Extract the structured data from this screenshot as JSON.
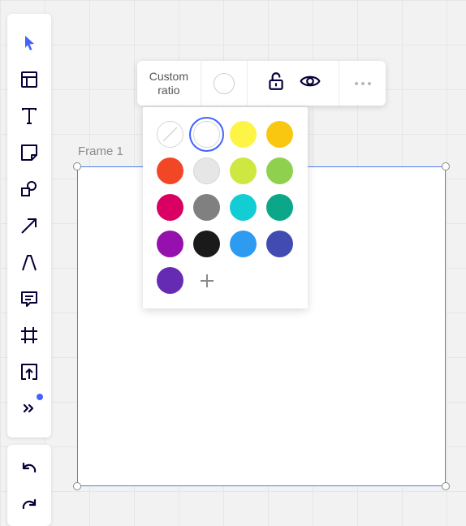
{
  "frame": {
    "label": "Frame 1"
  },
  "context_toolbar": {
    "ratio_line1": "Custom",
    "ratio_line2": "ratio"
  },
  "toolbar_icons": [
    "select-icon",
    "template-icon",
    "text-icon",
    "sticky-note-icon",
    "shapes-icon",
    "arrow-icon",
    "pen-icon",
    "comment-icon",
    "frame-icon",
    "upload-icon",
    "more-tools-icon"
  ],
  "palette": {
    "swatches": [
      "none",
      "#ffffff",
      "#fef445",
      "#fac710",
      "#f24726",
      "#e6e6e6",
      "#cee741",
      "#8fd14f",
      "#da0063",
      "#808080",
      "#12cdd4",
      "#0ca789",
      "#9510ac",
      "#1a1a1a",
      "#2d9bf0",
      "#414bb2",
      "#652cb3"
    ],
    "selected": "#ffffff"
  },
  "colors": {
    "accent": "#4262ff",
    "frame_border": "#4d7cf0",
    "icon": "#050038"
  }
}
